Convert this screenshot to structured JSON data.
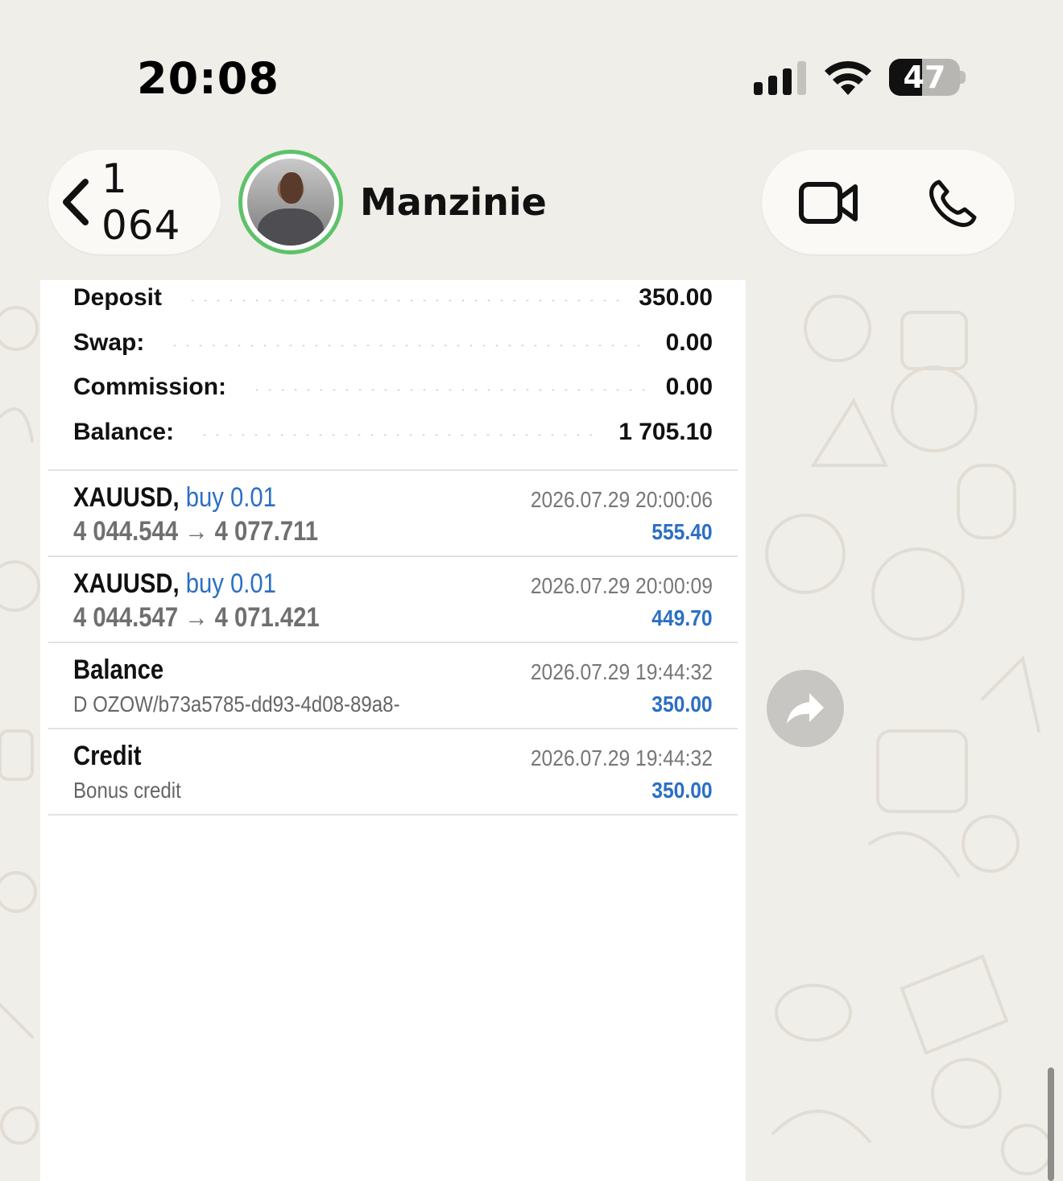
{
  "status_bar": {
    "time": "20:08",
    "battery": "47",
    "battery_level": 0.47,
    "signal_icon": "cellular-signal-icon",
    "wifi_icon": "wifi-icon"
  },
  "header": {
    "back_icon": "chevron-left-icon",
    "back_count": "1 064",
    "contact_name": "Manzinie",
    "video_icon": "video-camera-icon",
    "phone_icon": "phone-icon",
    "online_ring_color": "#5ec26a"
  },
  "screenshot": {
    "summary": [
      {
        "label": "Deposit",
        "value": "350.00"
      },
      {
        "label": "Swap:",
        "value": "0.00"
      },
      {
        "label": "Commission:",
        "value": "0.00"
      },
      {
        "label": "Balance:",
        "value": "1 705.10"
      }
    ],
    "deals": [
      {
        "symbol": "XAUUSD,",
        "side": "buy 0.01",
        "prices": "4 044.544 → 4 077.711",
        "time": "2026.07.29 20:00:06",
        "profit": "555.40"
      },
      {
        "symbol": "XAUUSD,",
        "side": "buy 0.01",
        "prices": "4 044.547 → 4 071.421",
        "time": "2026.07.29 20:00:09",
        "profit": "449.70"
      },
      {
        "symbol": "Balance",
        "side": "",
        "prices": "D OZOW/b73a5785-dd93-4d08-89a8-",
        "time": "2026.07.29 19:44:32",
        "profit": "350.00"
      },
      {
        "symbol": "Credit",
        "side": "",
        "prices": "Bonus credit",
        "time": "2026.07.29 19:44:32",
        "profit": "350.00"
      }
    ],
    "accent_color": "#2b6fc4"
  },
  "forward_icon": "forward-arrow-icon"
}
